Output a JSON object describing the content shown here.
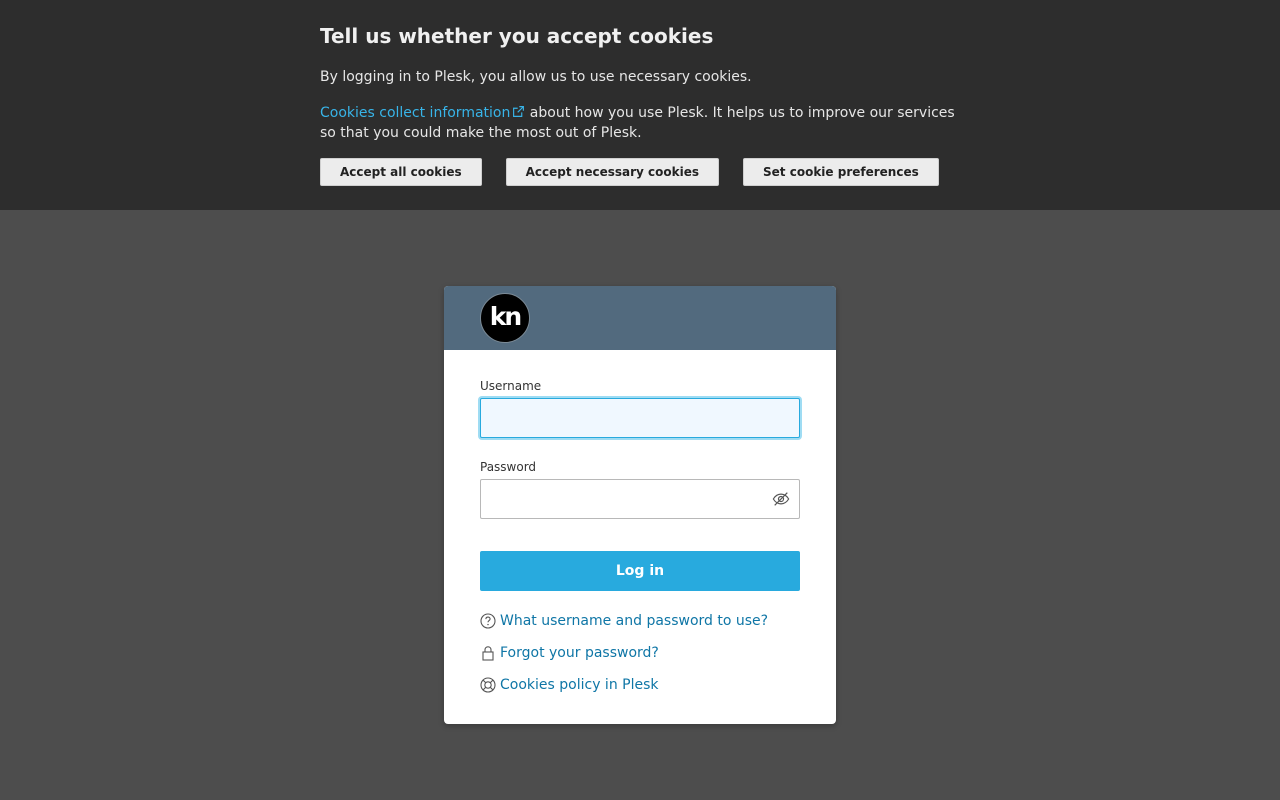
{
  "cookie_banner": {
    "title": "Tell us whether you accept cookies",
    "text1": "By logging in to Plesk, you allow us to use necessary cookies.",
    "link_text": "Cookies collect information",
    "text2": " about how you use Plesk. It helps us to improve our services so that you could make the most out of Plesk.",
    "buttons": {
      "accept_all": "Accept all cookies",
      "accept_necessary": "Accept necessary cookies",
      "preferences": "Set cookie preferences"
    }
  },
  "login": {
    "logo_text": "kn",
    "username_label": "Username",
    "username_value": "",
    "password_label": "Password",
    "password_value": "",
    "login_button": "Log in",
    "links": {
      "credentials_help": "What username and password to use?",
      "forgot_password": "Forgot your password?",
      "cookies_policy": "Cookies policy in Plesk"
    }
  },
  "icons": {
    "external_link": "external-link-icon",
    "eye": "eye-slash-icon",
    "question": "question-circle-icon",
    "lock": "lock-icon",
    "globe": "globe-icon"
  },
  "colors": {
    "banner_bg": "#2d2d2d",
    "page_bg": "#4d4d4d",
    "card_header": "#526a7e",
    "primary": "#28aade",
    "link": "#0f76a6",
    "banner_link": "#38b4e8"
  }
}
